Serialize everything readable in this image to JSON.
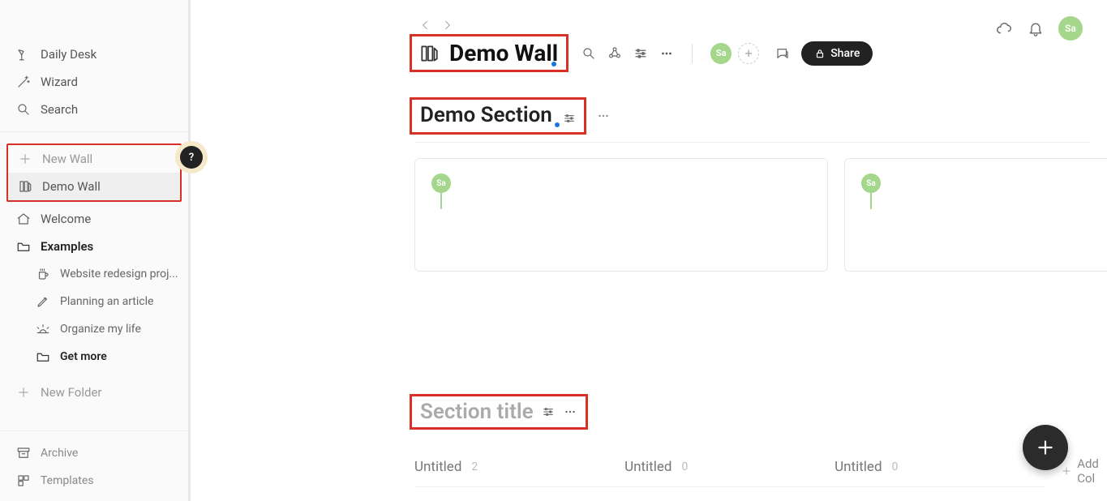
{
  "sidebar": {
    "daily_desk": "Daily Desk",
    "wizard": "Wizard",
    "search": "Search",
    "new_wall": "New Wall",
    "demo_wall": "Demo Wall",
    "welcome": "Welcome",
    "examples": "Examples",
    "sub_redesign": "Website redesign proj...",
    "sub_planning": "Planning an article",
    "sub_organize": "Organize my life",
    "sub_getmore": "Get more",
    "new_folder": "New Folder",
    "archive": "Archive",
    "templates": "Templates"
  },
  "help_bubble": "?",
  "header": {
    "avatar_initials": "Sa"
  },
  "wall": {
    "title": "Demo Wall",
    "avatar_initials": "Sa",
    "share_label": "Share"
  },
  "section1": {
    "title": "Demo Section",
    "card_avatar": "Sa"
  },
  "section2": {
    "title_placeholder": "Section title",
    "columns": [
      {
        "title": "Untitled",
        "count": "2"
      },
      {
        "title": "Untitled",
        "count": "0"
      },
      {
        "title": "Untitled",
        "count": "0"
      }
    ],
    "add_col": "Add Col"
  }
}
